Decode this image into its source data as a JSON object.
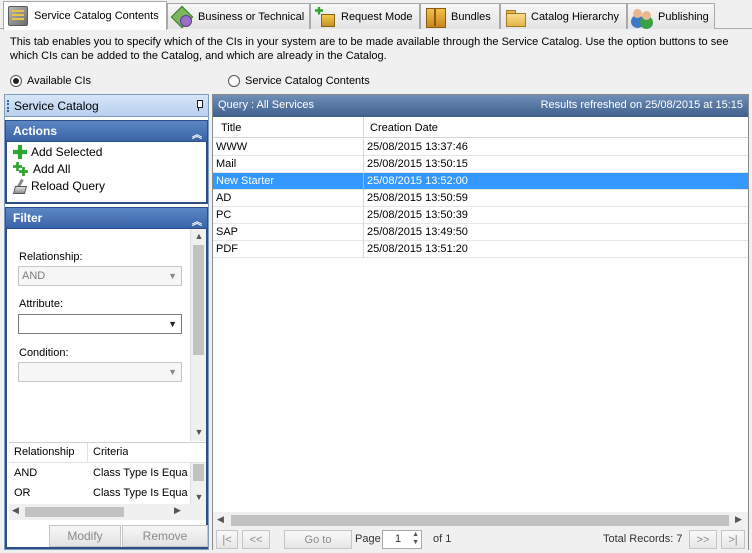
{
  "tabs": [
    {
      "label": "Service Catalog Contents",
      "icon": "catalog-book-icon",
      "active": true
    },
    {
      "label": "Business or Technical",
      "icon": "gem-icon",
      "active": false
    },
    {
      "label": "Request Mode",
      "icon": "request-package-icon",
      "active": false
    },
    {
      "label": "Bundles",
      "icon": "bundle-box-icon",
      "active": false
    },
    {
      "label": "Catalog Hierarchy",
      "icon": "folder-icon",
      "active": false
    },
    {
      "label": "Publishing",
      "icon": "people-icon",
      "active": false
    }
  ],
  "description": "This tab enables you to specify which of the CIs in your system are to be made available through the Service Catalog. Use the option buttons to see which CIs can be added to the Catalog, and which are already in the Catalog.",
  "view_options": {
    "available": "Available CIs",
    "contents": "Service Catalog Contents",
    "selected": "available"
  },
  "left_panel": {
    "title": "Service Catalog",
    "actions_title": "Actions",
    "actions": [
      {
        "label": "Add Selected",
        "icon": "add-icon"
      },
      {
        "label": "Add All",
        "icon": "add-all-icon"
      },
      {
        "label": "Reload Query",
        "icon": "broom-icon"
      }
    ],
    "filter_title": "Filter",
    "relationship_label": "Relationship:",
    "relationship_value": "AND",
    "attribute_label": "Attribute:",
    "attribute_value": "",
    "condition_label": "Condition:",
    "condition_value": "",
    "criteria": {
      "headers": [
        "Relationship",
        "Criteria"
      ],
      "rows": [
        [
          "AND",
          "Class Type Is Equa"
        ],
        [
          "OR",
          "Class Type Is Equa"
        ]
      ]
    },
    "modify_label": "Modify",
    "remove_label": "Remove"
  },
  "grid": {
    "query_label": "Query : All Services",
    "refreshed": "Results refreshed on 25/08/2015 at 15:15",
    "columns": [
      "Title",
      "Creation Date"
    ],
    "rows": [
      [
        "WWW",
        "25/08/2015 13:37:46"
      ],
      [
        "Mail",
        "25/08/2015 13:50:15"
      ],
      [
        "New Starter",
        "25/08/2015 13:52:00"
      ],
      [
        "AD",
        "25/08/2015 13:50:59"
      ],
      [
        "PC",
        "25/08/2015 13:50:39"
      ],
      [
        "SAP",
        "25/08/2015 13:49:50"
      ],
      [
        "PDF",
        "25/08/2015 13:51:20"
      ]
    ],
    "selected_row": 2
  },
  "pager": {
    "first": "|<",
    "prev": "<<",
    "goto": "Go to",
    "page_label": "Page",
    "page_value": "1",
    "of_label": "of 1",
    "total": "Total Records: 7",
    "next": ">>",
    "last": ">|"
  },
  "colors": {
    "header_blue": "#3a64a8",
    "selection": "#3399ff",
    "query_bar": "#4e6e98"
  }
}
